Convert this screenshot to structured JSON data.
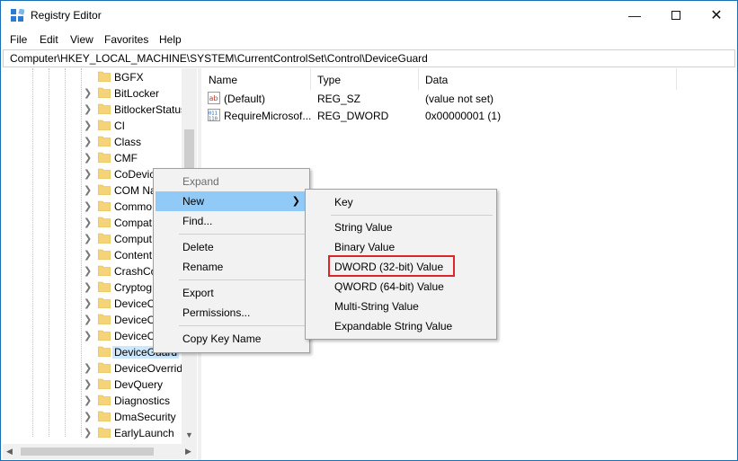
{
  "window": {
    "title": "Registry Editor"
  },
  "menubar": [
    "File",
    "Edit",
    "View",
    "Favorites",
    "Help"
  ],
  "address": "Computer\\HKEY_LOCAL_MACHINE\\SYSTEM\\CurrentControlSet\\Control\\DeviceGuard",
  "tree": {
    "items": [
      "BGFX",
      "BitLocker",
      "BitlockerStatus",
      "CI",
      "Class",
      "CMF",
      "CoDevic",
      "COM Na",
      "Commo",
      "Compat",
      "Comput",
      "Content",
      "CrashCo",
      "Cryptog",
      "DeviceC",
      "DeviceC",
      "DeviceC",
      "DeviceGuard",
      "DeviceOverrid",
      "DevQuery",
      "Diagnostics",
      "DmaSecurity",
      "EarlyLaunch"
    ],
    "selected": "DeviceGuard"
  },
  "list": {
    "columns": [
      "Name",
      "Type",
      "Data"
    ],
    "rows": [
      {
        "icon": "string-value-icon",
        "name": "(Default)",
        "type": "REG_SZ",
        "data": "(value not set)"
      },
      {
        "icon": "binary-value-icon",
        "name": "RequireMicrosof...",
        "type": "REG_DWORD",
        "data": "0x00000001 (1)"
      }
    ]
  },
  "context_menu": {
    "expand": "Expand",
    "new": "New",
    "find": "Find...",
    "delete": "Delete",
    "rename": "Rename",
    "export": "Export",
    "permissions": "Permissions...",
    "copy_key_name": "Copy Key Name"
  },
  "submenu": {
    "key": "Key",
    "string_value": "String Value",
    "binary_value": "Binary Value",
    "dword_value": "DWORD (32-bit) Value",
    "qword_value": "QWORD (64-bit) Value",
    "multi_string_value": "Multi-String Value",
    "expandable_string_value": "Expandable String Value"
  },
  "colors": {
    "highlight": "#91c9f7",
    "selection": "#cce8ff",
    "annotation": "#e0252a",
    "folder": "#f5d479"
  }
}
